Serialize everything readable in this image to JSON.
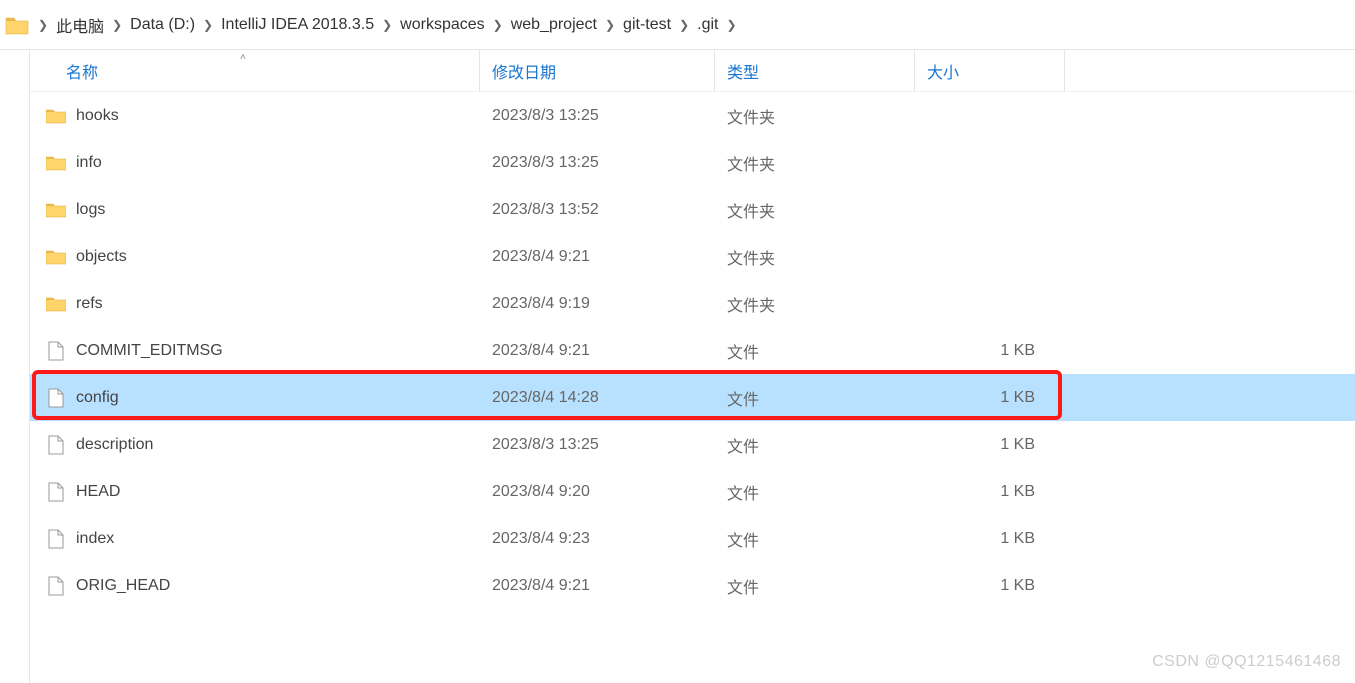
{
  "breadcrumb": {
    "items": [
      {
        "label": "此电脑"
      },
      {
        "label": "Data (D:)"
      },
      {
        "label": "IntelliJ IDEA 2018.3.5"
      },
      {
        "label": "workspaces"
      },
      {
        "label": "web_project"
      },
      {
        "label": "git-test"
      },
      {
        "label": ".git"
      }
    ]
  },
  "columns": {
    "name": "名称",
    "modified": "修改日期",
    "type": "类型",
    "size": "大小"
  },
  "files": [
    {
      "name": "hooks",
      "modified": "2023/8/3 13:25",
      "type": "文件夹",
      "size": "",
      "icon": "folder"
    },
    {
      "name": "info",
      "modified": "2023/8/3 13:25",
      "type": "文件夹",
      "size": "",
      "icon": "folder"
    },
    {
      "name": "logs",
      "modified": "2023/8/3 13:52",
      "type": "文件夹",
      "size": "",
      "icon": "folder"
    },
    {
      "name": "objects",
      "modified": "2023/8/4 9:21",
      "type": "文件夹",
      "size": "",
      "icon": "folder"
    },
    {
      "name": "refs",
      "modified": "2023/8/4 9:19",
      "type": "文件夹",
      "size": "",
      "icon": "folder"
    },
    {
      "name": "COMMIT_EDITMSG",
      "modified": "2023/8/4 9:21",
      "type": "文件",
      "size": "1 KB",
      "icon": "file"
    },
    {
      "name": "config",
      "modified": "2023/8/4 14:28",
      "type": "文件",
      "size": "1 KB",
      "icon": "file",
      "selected": true,
      "annotated": true
    },
    {
      "name": "description",
      "modified": "2023/8/3 13:25",
      "type": "文件",
      "size": "1 KB",
      "icon": "file"
    },
    {
      "name": "HEAD",
      "modified": "2023/8/4 9:20",
      "type": "文件",
      "size": "1 KB",
      "icon": "file"
    },
    {
      "name": "index",
      "modified": "2023/8/4 9:23",
      "type": "文件",
      "size": "1 KB",
      "icon": "file"
    },
    {
      "name": "ORIG_HEAD",
      "modified": "2023/8/4 9:21",
      "type": "文件",
      "size": "1 KB",
      "icon": "file"
    }
  ],
  "watermark": "CSDN @QQ1215461468"
}
